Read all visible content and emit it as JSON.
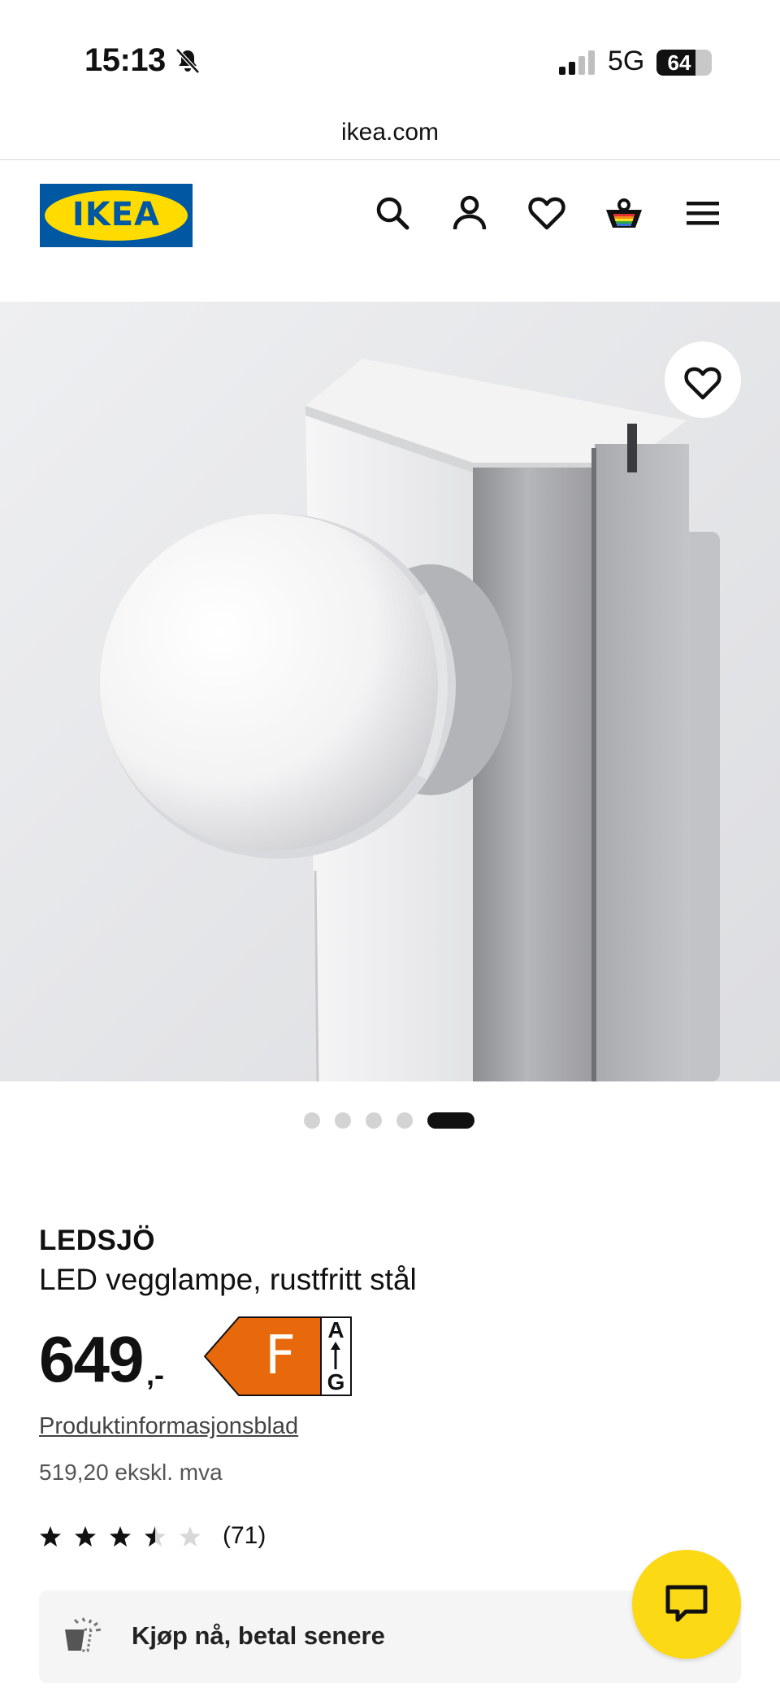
{
  "status_bar": {
    "time": "15:13",
    "network": "5G",
    "battery": "64"
  },
  "browser": {
    "url": "ikea.com"
  },
  "header": {
    "logo_text": "IKEA",
    "icons": [
      "search-icon",
      "account-icon",
      "heart-icon",
      "basket-icon",
      "menu-icon"
    ]
  },
  "gallery": {
    "slides": 5,
    "active_slide": 5
  },
  "product": {
    "name": "LEDSJÖ",
    "description": "LED vegglampe, rustfritt stål",
    "price": "649",
    "price_suffix": ",-",
    "energy_class": "F",
    "energy_scale_top": "A",
    "energy_scale_bottom": "G",
    "info_link": "Produktinformasjonsblad",
    "price_ex_vat": "519,20 ekskl. mva",
    "rating": 3.5,
    "rating_max": 5,
    "review_count": "(71)"
  },
  "payment_banner": {
    "label": "Kjøp nå, betal senere"
  },
  "colors": {
    "ikea_blue": "#0058a3",
    "ikea_yellow": "#ffdb00",
    "energy_orange": "#e8690b",
    "chat_yellow": "#fbd914"
  }
}
